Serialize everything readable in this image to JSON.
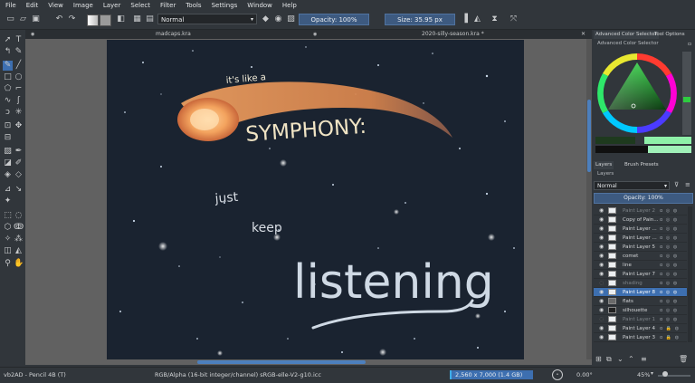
{
  "menu": [
    "File",
    "Edit",
    "View",
    "Image",
    "Layer",
    "Select",
    "Filter",
    "Tools",
    "Settings",
    "Window",
    "Help"
  ],
  "toolbar": {
    "blend_mode": "Normal",
    "opacity": "Opacity: 100%",
    "size": "Size: 35.95 px"
  },
  "tabs": [
    {
      "label": "madcaps.kra"
    },
    {
      "label": "2020-silly-season.kra *"
    }
  ],
  "artwork_text": {
    "line1": "it's like a",
    "line2": "SYMPHONY:",
    "line3": "just",
    "line4": "keep",
    "line5": "listening"
  },
  "dock": {
    "top_tabs": [
      "Advanced Color Selector",
      "Tool Options"
    ],
    "color_selector_title": "Advanced Color Selector",
    "layer_tabs": [
      "Layers",
      "Brush Presets"
    ],
    "layers_title": "Layers",
    "layer_blend": "Normal",
    "layer_opacity": "Opacity: 100%",
    "layers": [
      {
        "name": "Paint Layer 2",
        "dim": true,
        "active": false
      },
      {
        "name": "Copy of Pain...",
        "dim": false,
        "active": false
      },
      {
        "name": "Paint Layer ...",
        "dim": false,
        "active": false
      },
      {
        "name": "Paint Layer ...",
        "dim": false,
        "active": false
      },
      {
        "name": "Paint Layer 5",
        "dim": false,
        "active": false
      },
      {
        "name": "comet",
        "dim": false,
        "active": false
      },
      {
        "name": "line",
        "dim": false,
        "active": false
      },
      {
        "name": "Paint Layer 7",
        "dim": false,
        "active": false
      },
      {
        "name": "shading",
        "dim": true,
        "active": false
      },
      {
        "name": "Paint Layer 8",
        "dim": false,
        "active": true
      },
      {
        "name": "flats",
        "dim": false,
        "active": false
      },
      {
        "name": "silhouette",
        "dim": false,
        "active": false
      },
      {
        "name": "Paint Layer 1",
        "dim": true,
        "active": false
      },
      {
        "name": "Paint Layer 4",
        "dim": false,
        "active": false
      },
      {
        "name": "Paint Layer 3",
        "dim": false,
        "active": false
      }
    ]
  },
  "status": {
    "brush": "vb2AD - Pencil 4B (T)",
    "color_space": "RGB/Alpha (16-bit integer/channel)  sRGB-elle-V2-g10.icc",
    "dimensions": "2,560 x 7,000 (1.4 GB)",
    "rotation": "0.00°",
    "zoom": "45%"
  },
  "colors": {
    "accent": "#3daee9",
    "selection": "#3d6fb0",
    "canvas_bg": "#1a2330",
    "comet": "#f0a060"
  }
}
